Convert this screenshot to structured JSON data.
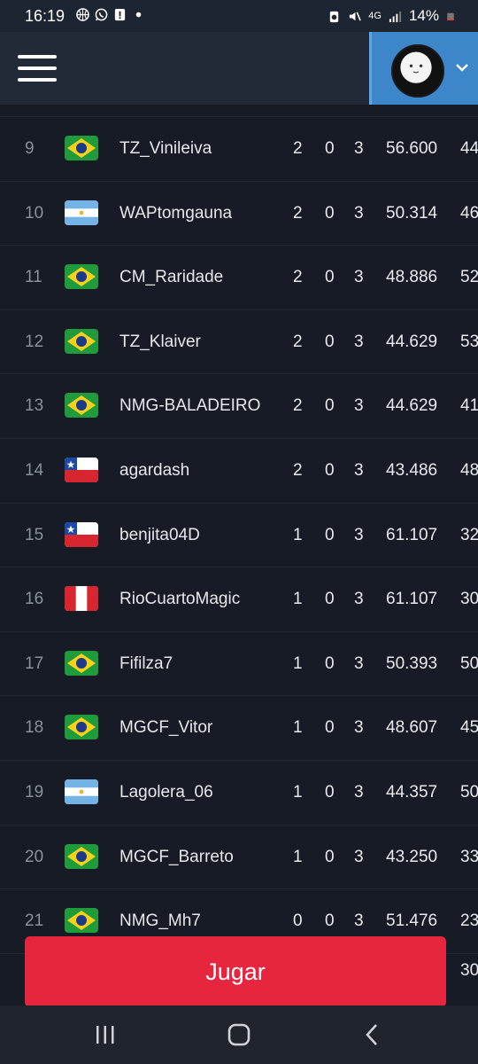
{
  "status": {
    "time": "16:19",
    "network": "4G",
    "battery": "14%"
  },
  "header": {
    "menu_icon": "hamburger-menu-icon",
    "avatar_icon": "face-avatar-icon",
    "dropdown_icon": "chevron-down-icon"
  },
  "colors": {
    "background": "#161b26",
    "header": "#222a38",
    "profile": "#3c86c9",
    "play": "#e6263f"
  },
  "rows": [
    {
      "rank": "9",
      "flag": "brazil",
      "name": "TZ_Vinileiva",
      "w": "2",
      "d": "0",
      "l": "3",
      "score": "56.600",
      "extra": "44"
    },
    {
      "rank": "10",
      "flag": "argentina",
      "name": "WAPtomgauna",
      "w": "2",
      "d": "0",
      "l": "3",
      "score": "50.314",
      "extra": "46"
    },
    {
      "rank": "11",
      "flag": "brazil",
      "name": "CM_Raridade",
      "w": "2",
      "d": "0",
      "l": "3",
      "score": "48.886",
      "extra": "52"
    },
    {
      "rank": "12",
      "flag": "brazil",
      "name": "TZ_Klaiver",
      "w": "2",
      "d": "0",
      "l": "3",
      "score": "44.629",
      "extra": "53"
    },
    {
      "rank": "13",
      "flag": "brazil",
      "name": "NMG-BALADEIRO",
      "w": "2",
      "d": "0",
      "l": "3",
      "score": "44.629",
      "extra": "41"
    },
    {
      "rank": "14",
      "flag": "chile",
      "name": "agardash",
      "w": "2",
      "d": "0",
      "l": "3",
      "score": "43.486",
      "extra": "48"
    },
    {
      "rank": "15",
      "flag": "chile",
      "name": "benjita04D",
      "w": "1",
      "d": "0",
      "l": "3",
      "score": "61.107",
      "extra": "32"
    },
    {
      "rank": "16",
      "flag": "peru",
      "name": "RioCuartoMagic",
      "w": "1",
      "d": "0",
      "l": "3",
      "score": "61.107",
      "extra": "30"
    },
    {
      "rank": "17",
      "flag": "brazil",
      "name": "Fifilza7",
      "w": "1",
      "d": "0",
      "l": "3",
      "score": "50.393",
      "extra": "50"
    },
    {
      "rank": "18",
      "flag": "brazil",
      "name": "MGCF_Vitor",
      "w": "1",
      "d": "0",
      "l": "3",
      "score": "48.607",
      "extra": "45"
    },
    {
      "rank": "19",
      "flag": "argentina",
      "name": "Lagolera_06",
      "w": "1",
      "d": "0",
      "l": "3",
      "score": "44.357",
      "extra": "50"
    },
    {
      "rank": "20",
      "flag": "brazil",
      "name": "MGCF_Barreto",
      "w": "1",
      "d": "0",
      "l": "3",
      "score": "43.250",
      "extra": "33"
    },
    {
      "rank": "21",
      "flag": "brazil",
      "name": "NMG_Mh7",
      "w": "0",
      "d": "0",
      "l": "3",
      "score": "51.476",
      "extra": "23"
    }
  ],
  "play": {
    "label": "Jugar",
    "extra": "30"
  },
  "nav": {
    "recents_icon": "recents-icon",
    "home_icon": "home-icon",
    "back_icon": "back-icon"
  }
}
